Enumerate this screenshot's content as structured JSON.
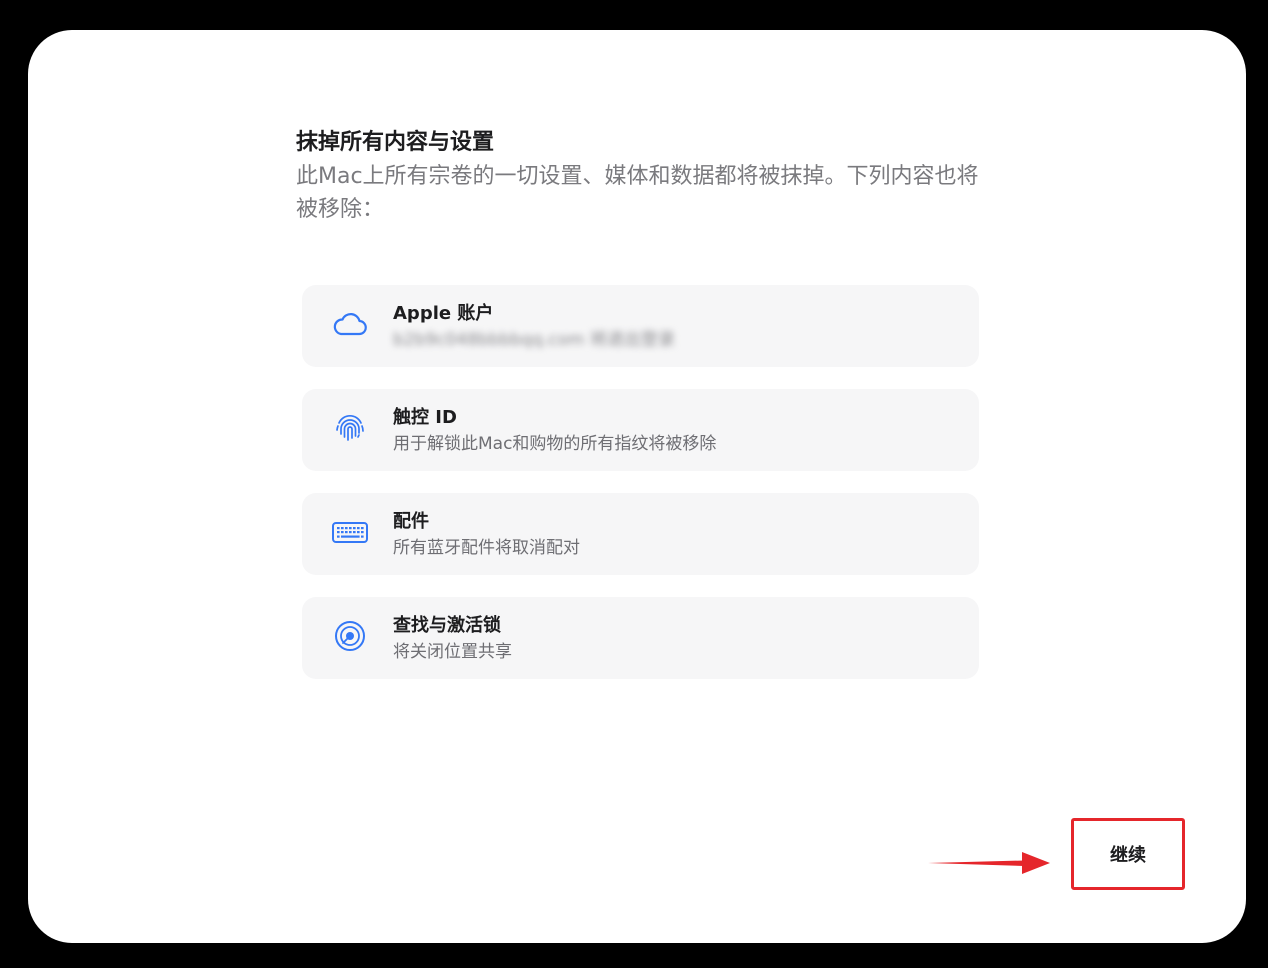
{
  "header": {
    "title": "抹掉所有内容与设置",
    "subtitle": "此Mac上所有宗卷的一切设置、媒体和数据都将被抹掉。下列内容也将被移除："
  },
  "items": [
    {
      "icon": "cloud-icon",
      "title": "Apple 账户",
      "desc": "b2b9c048bbbbqq.com 将退出登录"
    },
    {
      "icon": "fingerprint-icon",
      "title": "触控 ID",
      "desc": "用于解锁此Mac和购物的所有指纹将被移除"
    },
    {
      "icon": "keyboard-icon",
      "title": "配件",
      "desc": "所有蓝牙配件将取消配对"
    },
    {
      "icon": "find-my-icon",
      "title": "查找与激活锁",
      "desc": "将关闭位置共享"
    }
  ],
  "footer": {
    "continue_label": "继续"
  },
  "colors": {
    "accent": "#3478f6",
    "annotation": "#e5262b",
    "card_bg": "#f6f6f7"
  }
}
